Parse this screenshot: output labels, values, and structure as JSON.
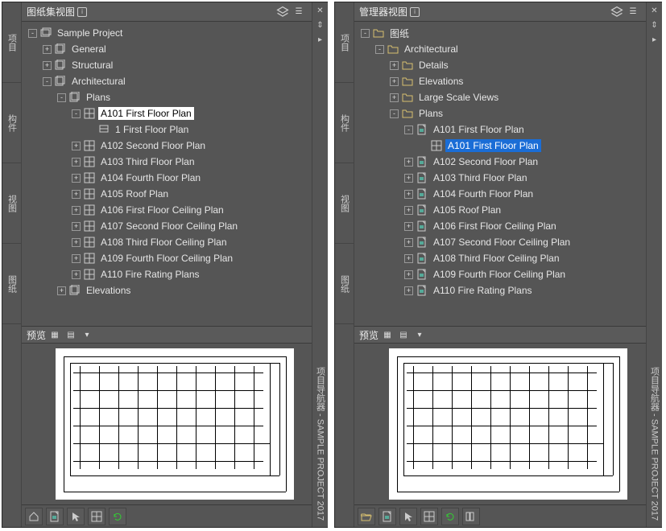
{
  "leftPanel": {
    "title": "图纸集视图",
    "tabs": [
      "项目",
      "构件",
      "视图",
      "图纸"
    ],
    "rightLabel": "项目导航器 - SAMPLE PROJECT 2017",
    "tree": [
      {
        "d": 0,
        "exp": "-",
        "icon": "set",
        "label": "Sample Project"
      },
      {
        "d": 1,
        "exp": "+",
        "icon": "sheet",
        "label": "General"
      },
      {
        "d": 1,
        "exp": "+",
        "icon": "sheet",
        "label": "Structural"
      },
      {
        "d": 1,
        "exp": "-",
        "icon": "sheet",
        "label": "Architectural"
      },
      {
        "d": 2,
        "exp": "-",
        "icon": "sheet",
        "label": "Plans"
      },
      {
        "d": 3,
        "exp": "-",
        "icon": "plan",
        "label": "A101 First Floor Plan",
        "sel": "a"
      },
      {
        "d": 4,
        "exp": "",
        "icon": "view",
        "label": "1 First Floor Plan"
      },
      {
        "d": 3,
        "exp": "+",
        "icon": "plan",
        "label": "A102 Second Floor Plan"
      },
      {
        "d": 3,
        "exp": "+",
        "icon": "plan",
        "label": "A103 Third Floor Plan"
      },
      {
        "d": 3,
        "exp": "+",
        "icon": "plan",
        "label": "A104 Fourth Floor Plan"
      },
      {
        "d": 3,
        "exp": "+",
        "icon": "plan",
        "label": "A105 Roof Plan"
      },
      {
        "d": 3,
        "exp": "+",
        "icon": "plan",
        "label": "A106 First Floor Ceiling Plan"
      },
      {
        "d": 3,
        "exp": "+",
        "icon": "plan",
        "label": "A107 Second Floor Ceiling Plan"
      },
      {
        "d": 3,
        "exp": "+",
        "icon": "plan",
        "label": "A108 Third Floor Ceiling Plan"
      },
      {
        "d": 3,
        "exp": "+",
        "icon": "plan",
        "label": "A109 Fourth Floor Ceiling Plan"
      },
      {
        "d": 3,
        "exp": "+",
        "icon": "plan",
        "label": "A110 Fire Rating Plans"
      },
      {
        "d": 2,
        "exp": "+",
        "icon": "sheet",
        "label": "Elevations"
      }
    ],
    "preview": "预览",
    "toolbarIcons": [
      "home",
      "dwg",
      "cursor",
      "grid",
      "refresh"
    ]
  },
  "rightPanel": {
    "title": "管理器视图",
    "tabs": [
      "项目",
      "构件",
      "视图",
      "图纸"
    ],
    "rightLabel": "项目导航器 - SAMPLE PROJECT 2017",
    "tree": [
      {
        "d": 0,
        "exp": "-",
        "icon": "folder",
        "label": "图纸"
      },
      {
        "d": 1,
        "exp": "-",
        "icon": "folder",
        "label": "Architectural"
      },
      {
        "d": 2,
        "exp": "+",
        "icon": "folder",
        "label": "Details"
      },
      {
        "d": 2,
        "exp": "+",
        "icon": "folder",
        "label": "Elevations"
      },
      {
        "d": 2,
        "exp": "+",
        "icon": "folder",
        "label": "Large Scale Views"
      },
      {
        "d": 2,
        "exp": "-",
        "icon": "folder",
        "label": "Plans"
      },
      {
        "d": 3,
        "exp": "-",
        "icon": "dwg",
        "label": "A101 First Floor Plan"
      },
      {
        "d": 4,
        "exp": "",
        "icon": "plan",
        "label": "A101 First Floor Plan",
        "sel": "b"
      },
      {
        "d": 3,
        "exp": "+",
        "icon": "dwg",
        "label": "A102 Second Floor Plan"
      },
      {
        "d": 3,
        "exp": "+",
        "icon": "dwg",
        "label": "A103 Third Floor Plan"
      },
      {
        "d": 3,
        "exp": "+",
        "icon": "dwg",
        "label": "A104 Fourth Floor Plan"
      },
      {
        "d": 3,
        "exp": "+",
        "icon": "dwg",
        "label": "A105 Roof Plan"
      },
      {
        "d": 3,
        "exp": "+",
        "icon": "dwg",
        "label": "A106 First Floor Ceiling Plan"
      },
      {
        "d": 3,
        "exp": "+",
        "icon": "dwg",
        "label": "A107 Second Floor Ceiling Plan"
      },
      {
        "d": 3,
        "exp": "+",
        "icon": "dwg",
        "label": "A108 Third Floor Ceiling Plan"
      },
      {
        "d": 3,
        "exp": "+",
        "icon": "dwg",
        "label": "A109 Fourth Floor Ceiling Plan"
      },
      {
        "d": 3,
        "exp": "+",
        "icon": "dwg",
        "label": "A110 Fire Rating Plans"
      }
    ],
    "preview": "预览",
    "toolbarIcons": [
      "folder-open",
      "dwg",
      "cursor",
      "grid",
      "refresh",
      "columns"
    ]
  },
  "iconSvg": {
    "set": "<rect x='1' y='3' width='10' height='8' fill='none' stroke='#ccc'/><rect x='3' y='1' width='10' height='8' fill='none' stroke='#ccc'/>",
    "sheet": "<rect x='1' y='2' width='9' height='10' fill='none' stroke='#ccc'/><rect x='3' y='0' width='9' height='10' fill='none' stroke='#ccc'/>",
    "plan": "<rect x='1' y='1' width='12' height='12' fill='none' stroke='#ccc'/><line x1='1' y1='7' x2='13' y2='7' stroke='#ccc'/><line x1='7' y1='1' x2='7' y2='13' stroke='#ccc'/>",
    "view": "<rect x='2' y='2' width='10' height='8' fill='none' stroke='#ccc'/><line x1='2' y1='6' x2='12' y2='6' stroke='#ccc'/>",
    "folder": "<path d='M1 3 h4 l1 2 h7 v7 h-12 z' fill='none' stroke='#d8c070'/>",
    "dwg": "<rect x='2' y='1' width='9' height='12' fill='none' stroke='#ccc'/><path d='M8 1 l3 3' stroke='#ccc'/><rect x='4' y='6' width='5' height='4' fill='#5a9'/>",
    "home": "<path d='M2 7 l5 -5 l5 5 v5 h-10 z' fill='none' stroke='#ccc'/>",
    "cursor": "<path d='M3 2 l0 10 l3 -3 l2 4 l2 -1 l-2 -4 l4 0 z' fill='#ccc'/>",
    "grid": "<rect x='1' y='1' width='12' height='12' fill='none' stroke='#ccc'/><line x1='1' y1='7' x2='13' y2='7' stroke='#ccc'/><line x1='7' y1='1' x2='7' y2='13' stroke='#ccc'/>",
    "refresh": "<path d='M3 7 a4 4 0 1 1 1 3' fill='none' stroke='#3c3'/><path d='M3 4 l0 3 l3 0' fill='none' stroke='#3c3'/>",
    "folder-open": "<path d='M1 4 h4 l1 1 h6 v1 h-12 z M1 6 h12 l-2 6 h-10 z' fill='none' stroke='#d8c070'/>",
    "columns": "<rect x='1' y='2' width='4' height='10' fill='none' stroke='#ccc'/><rect x='6' y='2' width='4' height='10' fill='none' stroke='#ccc'/>",
    "layers": "<path d='M2 5 l5 -3 l5 3 l-5 3 z M2 8 l5 3 l5 -3' fill='none' stroke='#ccc'/>",
    "expand": "<path d='M2 6 l5 -4 l5 4 M2 8 l5 4 l5 -4' fill='none' stroke='#ccc'/>"
  }
}
